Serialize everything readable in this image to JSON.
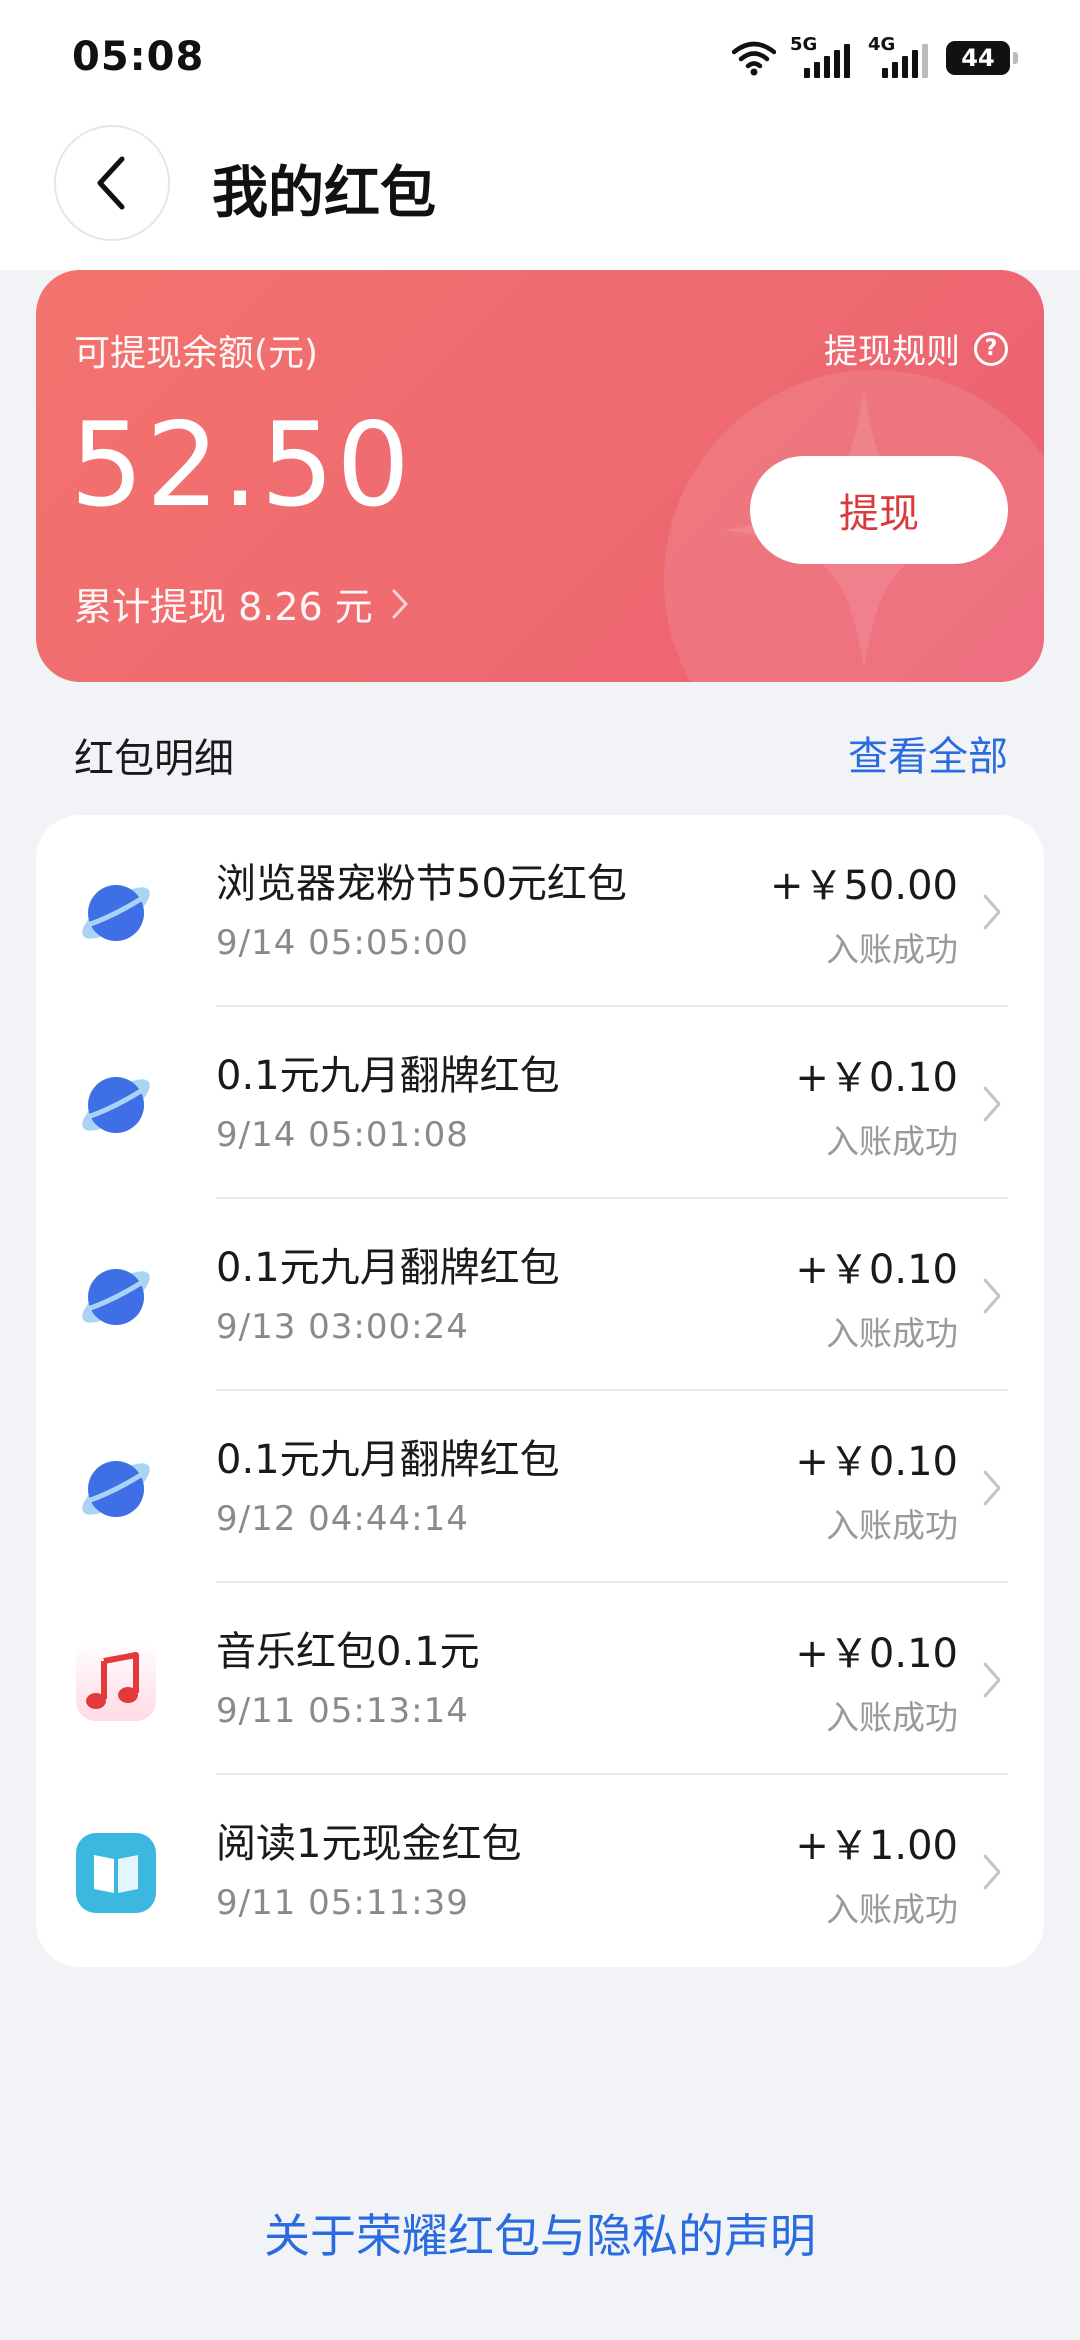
{
  "status_bar": {
    "time": "05:08",
    "network_1": "5G",
    "network_2": "4G",
    "battery": "44"
  },
  "header": {
    "title": "我的红包"
  },
  "balance_card": {
    "label": "可提现余额(元)",
    "rules_label": "提现规则",
    "amount": "52.50",
    "cumulative": "累计提现 8.26 元",
    "withdraw_label": "提现"
  },
  "details": {
    "section_title": "红包明细",
    "view_all_label": "查看全部",
    "items": [
      {
        "icon": "browser-icon",
        "title": "浏览器宠粉节50元红包",
        "time": "9/14 05:05:00",
        "amount": "+￥50.00",
        "status": "入账成功"
      },
      {
        "icon": "browser-icon",
        "title": "0.1元九月翻牌红包",
        "time": "9/14 05:01:08",
        "amount": "+￥0.10",
        "status": "入账成功"
      },
      {
        "icon": "browser-icon",
        "title": "0.1元九月翻牌红包",
        "time": "9/13 03:00:24",
        "amount": "+￥0.10",
        "status": "入账成功"
      },
      {
        "icon": "browser-icon",
        "title": "0.1元九月翻牌红包",
        "time": "9/12 04:44:14",
        "amount": "+￥0.10",
        "status": "入账成功"
      },
      {
        "icon": "music-icon",
        "title": "音乐红包0.1元",
        "time": "9/11 05:13:14",
        "amount": "+￥0.10",
        "status": "入账成功"
      },
      {
        "icon": "reader-icon",
        "title": "阅读1元现金红包",
        "time": "9/11 05:11:39",
        "amount": "+￥1.00",
        "status": "入账成功"
      }
    ]
  },
  "footer": {
    "link_label": "关于荣耀红包与隐私的声明"
  },
  "colors": {
    "card_gradient_start": "#f3736d",
    "card_gradient_end": "#ec5f72",
    "link_blue": "#2a6ce0",
    "withdraw_text": "#d93a3a"
  }
}
